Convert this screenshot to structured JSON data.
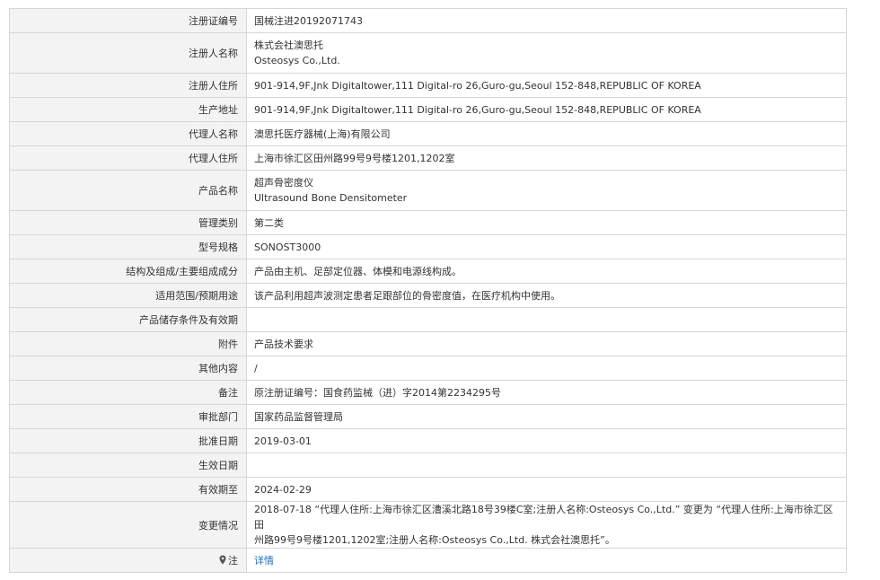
{
  "rows": [
    {
      "label": "注册证编号",
      "lines": [
        "国械注进20192071743"
      ]
    },
    {
      "label": "注册人名称",
      "lines": [
        "株式会社澳思托",
        "Osteosys Co.,Ltd."
      ]
    },
    {
      "label": "注册人住所",
      "lines": [
        "901-914,9F,Jnk Digitaltower,111 Digital-ro 26,Guro-gu,Seoul 152-848,REPUBLIC OF KOREA"
      ]
    },
    {
      "label": "生产地址",
      "lines": [
        "901-914,9F,Jnk Digitaltower,111 Digital-ro 26,Guro-gu,Seoul 152-848,REPUBLIC OF KOREA"
      ]
    },
    {
      "label": "代理人名称",
      "lines": [
        "澳思托医疗器械(上海)有限公司"
      ]
    },
    {
      "label": "代理人住所",
      "lines": [
        "上海市徐汇区田州路99号9号楼1201,1202室"
      ]
    },
    {
      "label": "产品名称",
      "lines": [
        "超声骨密度仪",
        "Ultrasound Bone Densitometer"
      ]
    },
    {
      "label": "管理类别",
      "lines": [
        "第二类"
      ]
    },
    {
      "label": "型号规格",
      "lines": [
        "SONOST3000"
      ]
    },
    {
      "label": "结构及组成/主要组成成分",
      "lines": [
        "产品由主机、足部定位器、体模和电源线构成。"
      ]
    },
    {
      "label": "适用范围/预期用途",
      "lines": [
        "该产品利用超声波测定患者足跟部位的骨密度值，在医疗机构中使用。"
      ]
    },
    {
      "label": "产品储存条件及有效期",
      "lines": [
        ""
      ]
    },
    {
      "label": "附件",
      "lines": [
        "产品技术要求"
      ]
    },
    {
      "label": "其他内容",
      "lines": [
        "/"
      ]
    },
    {
      "label": "备注",
      "lines": [
        "原注册证编号：国食药监械（进）字2014第2234295号"
      ]
    },
    {
      "label": "审批部门",
      "lines": [
        "国家药品监督管理局"
      ]
    },
    {
      "label": "批准日期",
      "lines": [
        "2019-03-01"
      ]
    },
    {
      "label": "生效日期",
      "lines": [
        ""
      ]
    },
    {
      "label": "有效期至",
      "lines": [
        "2024-02-29"
      ]
    },
    {
      "label": "变更情况",
      "lines": [
        "2018-07-18 “代理人住所:上海市徐汇区漕溪北路18号39楼C室;注册人名称:Osteosys Co.,Ltd.” 变更为 “代理人住所:上海市徐汇区田",
        "州路99号9号楼1201,1202室;注册人名称:Osteosys Co.,Ltd. 株式会社澳思托”。"
      ]
    }
  ],
  "note_row": {
    "label": "注",
    "icon": "location-pin-icon",
    "link_text": "详情"
  }
}
